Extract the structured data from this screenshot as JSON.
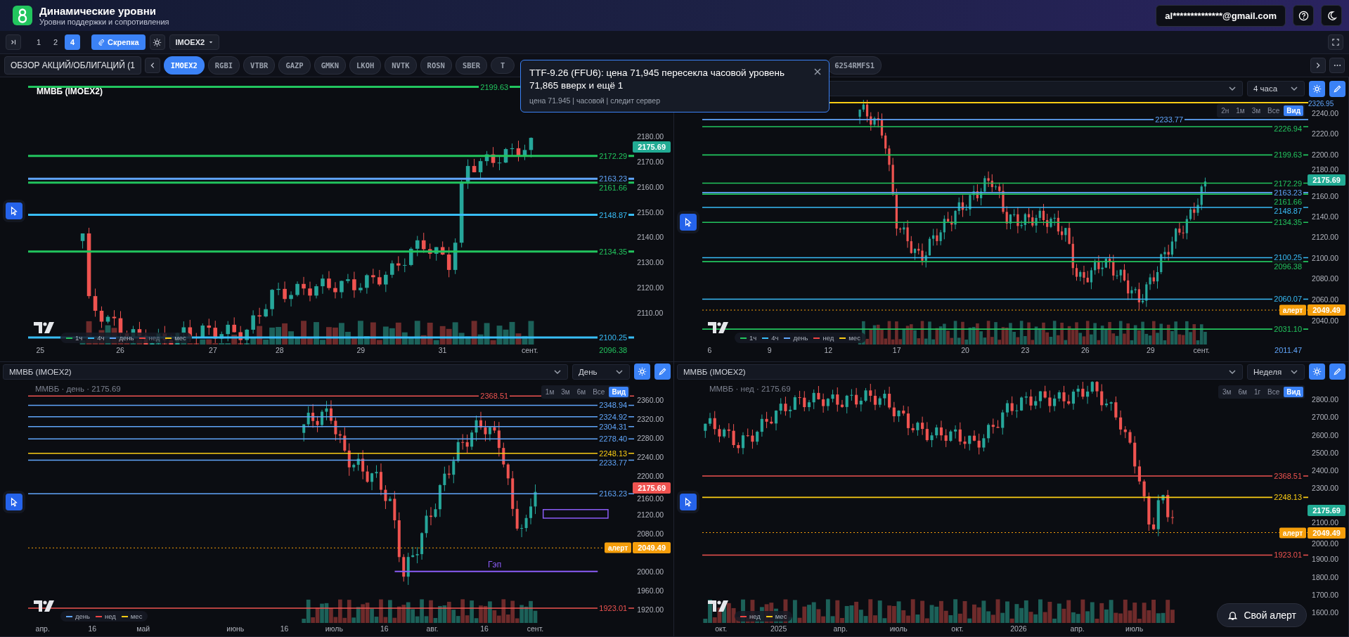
{
  "app": {
    "title": "Динамические уровни",
    "subtitle": "Уровни поддержки и сопротивления",
    "account": "al**************@gmail.com"
  },
  "toolbar": {
    "layouts": [
      {
        "label": "1",
        "selected": false
      },
      {
        "label": "2",
        "selected": false
      },
      {
        "label": "4",
        "selected": true
      }
    ],
    "clip": "Скрепка",
    "symbol": "IMOEX2"
  },
  "tickers": {
    "group": "ОБЗОР АКЦИЙ/ОБЛИГАЦИЙ (1",
    "items": [
      {
        "label": "IMOEX2",
        "selected": true
      },
      {
        "label": "RGBI",
        "selected": false
      },
      {
        "label": "VTBR",
        "selected": false
      },
      {
        "label": "GAZP",
        "selected": false
      },
      {
        "label": "GMKN",
        "selected": false
      },
      {
        "label": "LKOH",
        "selected": false
      },
      {
        "label": "NVTK",
        "selected": false
      },
      {
        "label": "ROSN",
        "selected": false
      },
      {
        "label": "SBER",
        "selected": false
      },
      {
        "label": "T",
        "selected": false
      },
      {
        "label": "6254RMFS1",
        "selected": false
      }
    ]
  },
  "notification": {
    "title": "TTF-9.26 (FFU6): цена 71,945 пересекла часовой уровень 71,865 вверх и ещё 1",
    "details": "цена 71.945 | часовой | следит сервер"
  },
  "panels": [
    {
      "title": "ММВБ (IMOEX2)",
      "yticks": [
        "2180.00",
        "2170.00",
        "2160.00",
        "2150.00",
        "2140.00",
        "2130.00",
        "2120.00",
        "2110.00"
      ],
      "xticks": [
        "25",
        "26",
        "27",
        "28",
        "29",
        "31",
        "сент."
      ],
      "levels": [
        {
          "value": "2199.63",
          "color": "#22c55e"
        },
        {
          "value": "2172.29",
          "color": "#22c55e"
        },
        {
          "value": "2163.23",
          "color": "#60a5fa"
        },
        {
          "value": "2161.66",
          "color": "#22c55e"
        },
        {
          "value": "2148.87",
          "color": "#38bdf8"
        },
        {
          "value": "2134.35",
          "color": "#22c55e"
        },
        {
          "value": "2100.25",
          "color": "#38bdf8"
        },
        {
          "value": "2096.38",
          "color": "#22c55e"
        }
      ],
      "price": {
        "value": "2175.69",
        "color": "#22ab94"
      },
      "legend": [
        {
          "label": "1ч",
          "color": "#22c55e",
          "on": true
        },
        {
          "label": "4ч",
          "color": "#38bdf8",
          "on": true
        },
        {
          "label": "день",
          "color": "#60a5fa",
          "on": true
        },
        {
          "label": "нед",
          "color": "#ef4444",
          "on": false
        },
        {
          "label": "мес",
          "color": "#facc15",
          "on": true
        }
      ]
    },
    {
      "header": {
        "timeframe": "4 часа"
      },
      "ranges": [
        {
          "label": "2н",
          "selected": false
        },
        {
          "label": "1м",
          "selected": false
        },
        {
          "label": "3м",
          "selected": false
        },
        {
          "label": "Все",
          "selected": false
        },
        {
          "label": "Вид",
          "selected": true
        }
      ],
      "yticks": [
        "2240.00",
        "2220.00",
        "2200.00",
        "2180.00",
        "2160.00",
        "2140.00",
        "2120.00",
        "2100.00",
        "2080.00",
        "2060.00",
        "2040.00"
      ],
      "xticks": [
        "6",
        "9",
        "12",
        "17",
        "20",
        "23",
        "26",
        "29",
        "сент."
      ],
      "levels": [
        {
          "value": "2326.95",
          "color": "#60a5fa"
        },
        {
          "value": "2233.77",
          "color": "#60a5fa"
        },
        {
          "value": "2226.94",
          "color": "#22c55e"
        },
        {
          "value": "2199.63",
          "color": "#22c55e"
        },
        {
          "value": "2172.29",
          "color": "#22c55e"
        },
        {
          "value": "2163.23",
          "color": "#60a5fa"
        },
        {
          "value": "2161.66",
          "color": "#22c55e"
        },
        {
          "value": "2148.87",
          "color": "#38bdf8"
        },
        {
          "value": "2134.35",
          "color": "#22c55e"
        },
        {
          "value": "2100.25",
          "color": "#38bdf8"
        },
        {
          "value": "2096.38",
          "color": "#22c55e"
        },
        {
          "value": "2060.07",
          "color": "#38bdf8"
        },
        {
          "value": "2031.10",
          "color": "#22c55e"
        },
        {
          "value": "2011.47",
          "color": "#60a5fa"
        }
      ],
      "price": {
        "value": "2175.69",
        "color": "#22ab94"
      },
      "alert": {
        "label": "алерт",
        "value": "2049.49"
      },
      "legend": [
        {
          "label": "1ч",
          "color": "#22c55e",
          "on": true
        },
        {
          "label": "4ч",
          "color": "#38bdf8",
          "on": true
        },
        {
          "label": "день",
          "color": "#60a5fa",
          "on": true
        },
        {
          "label": "нед",
          "color": "#ef4444",
          "on": true
        },
        {
          "label": "мес",
          "color": "#facc15",
          "on": true
        }
      ]
    },
    {
      "header": {
        "symbol": "ММВБ (IMOEX2)",
        "timeframe": "День"
      },
      "watermark": "ММВБ · день · 2175.69",
      "ranges": [
        {
          "label": "1м",
          "selected": false
        },
        {
          "label": "3м",
          "selected": false
        },
        {
          "label": "6м",
          "selected": false
        },
        {
          "label": "Все",
          "selected": false
        },
        {
          "label": "Вид",
          "selected": true
        }
      ],
      "yticks": [
        "2360.00",
        "2320.00",
        "2280.00",
        "2240.00",
        "2200.00",
        "2160.00",
        "2120.00",
        "2080.00",
        "2000.00",
        "1960.00",
        "1920.00"
      ],
      "xticks": [
        "апр.",
        "16",
        "май",
        "июнь",
        "16",
        "июль",
        "16",
        "авг.",
        "16",
        "сент."
      ],
      "levels": [
        {
          "value": "2368.51",
          "color": "#ef5350"
        },
        {
          "value": "2348.94",
          "color": "#60a5fa"
        },
        {
          "value": "2324.92",
          "color": "#60a5fa"
        },
        {
          "value": "2304.31",
          "color": "#60a5fa"
        },
        {
          "value": "2278.40",
          "color": "#60a5fa"
        },
        {
          "value": "2248.13",
          "color": "#facc15"
        },
        {
          "value": "2233.77",
          "color": "#60a5fa"
        },
        {
          "value": "2163.23",
          "color": "#60a5fa"
        },
        {
          "value": "1923.01",
          "color": "#ef5350"
        }
      ],
      "price": {
        "value": "2175.69",
        "color": "#ef5350"
      },
      "alert": {
        "label": "алерт",
        "value": "2049.49"
      },
      "gap": {
        "label": "Гэп"
      },
      "legend": [
        {
          "label": "день",
          "color": "#60a5fa",
          "on": true
        },
        {
          "label": "нед",
          "color": "#ef4444",
          "on": true
        },
        {
          "label": "мес",
          "color": "#facc15",
          "on": true
        }
      ]
    },
    {
      "header": {
        "symbol": "ММВБ (IMOEX2)",
        "timeframe": "Неделя"
      },
      "watermark": "ММВБ · нед · 2175.69",
      "ranges": [
        {
          "label": "3м",
          "selected": false
        },
        {
          "label": "6м",
          "selected": false
        },
        {
          "label": "1г",
          "selected": false
        },
        {
          "label": "Все",
          "selected": false
        },
        {
          "label": "Вид",
          "selected": true
        }
      ],
      "yticks": [
        "2800.00",
        "2700.00",
        "2600.00",
        "2500.00",
        "2400.00",
        "2300.00",
        "2100.00",
        "2000.00",
        "1900.00",
        "1800.00",
        "1700.00",
        "1600.00"
      ],
      "xticks": [
        "окт.",
        "2025",
        "апр.",
        "июль",
        "окт.",
        "2026",
        "апр.",
        "июль"
      ],
      "levels": [
        {
          "value": "2368.51",
          "color": "#ef5350"
        },
        {
          "value": "2248.13",
          "color": "#facc15"
        },
        {
          "value": "1923.01",
          "color": "#ef5350"
        }
      ],
      "price": {
        "value": "2175.69",
        "color": "#22ab94"
      },
      "alert": {
        "label": "алерт",
        "value": "2049.49"
      },
      "legend": [
        {
          "label": "нед",
          "color": "#ef4444",
          "on": true
        },
        {
          "label": "мес",
          "color": "#facc15",
          "on": true
        }
      ]
    }
  ],
  "alert_button": "Свой алерт"
}
